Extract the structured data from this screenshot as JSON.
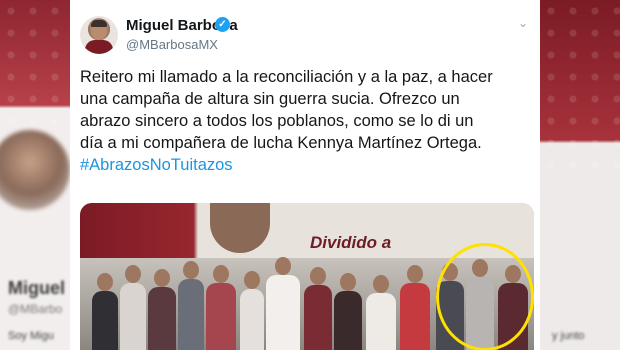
{
  "tweet": {
    "author_name": "Miguel Barbosa",
    "author_handle": "@MBarbosaMX",
    "verified_symbol": "✓",
    "menu_symbol": "⌄",
    "text_lines": [
      "Reitero mi llamado a la reconciliación y a la paz, a hacer",
      "una campaña de altura sin guerra sucia. Ofrezco un",
      "abrazo sincero a todos los poblanos, como se lo di un",
      "día a mi compañera de lucha Kennya Martínez Ortega."
    ],
    "hashtag": "#AbrazosNoTuitazos"
  },
  "photo": {
    "banner_text": "Dividido a"
  },
  "background": {
    "blurred_name": "Miguel",
    "blurred_handle": "@MBarbo",
    "blurred_text_left": "Soy Migu",
    "blurred_text_right": "y junto"
  },
  "colors": {
    "link": "#1b95e0",
    "verified": "#1da1f2",
    "highlight_circle": "#ffe100",
    "brand_maroon": "#7b1b24"
  }
}
